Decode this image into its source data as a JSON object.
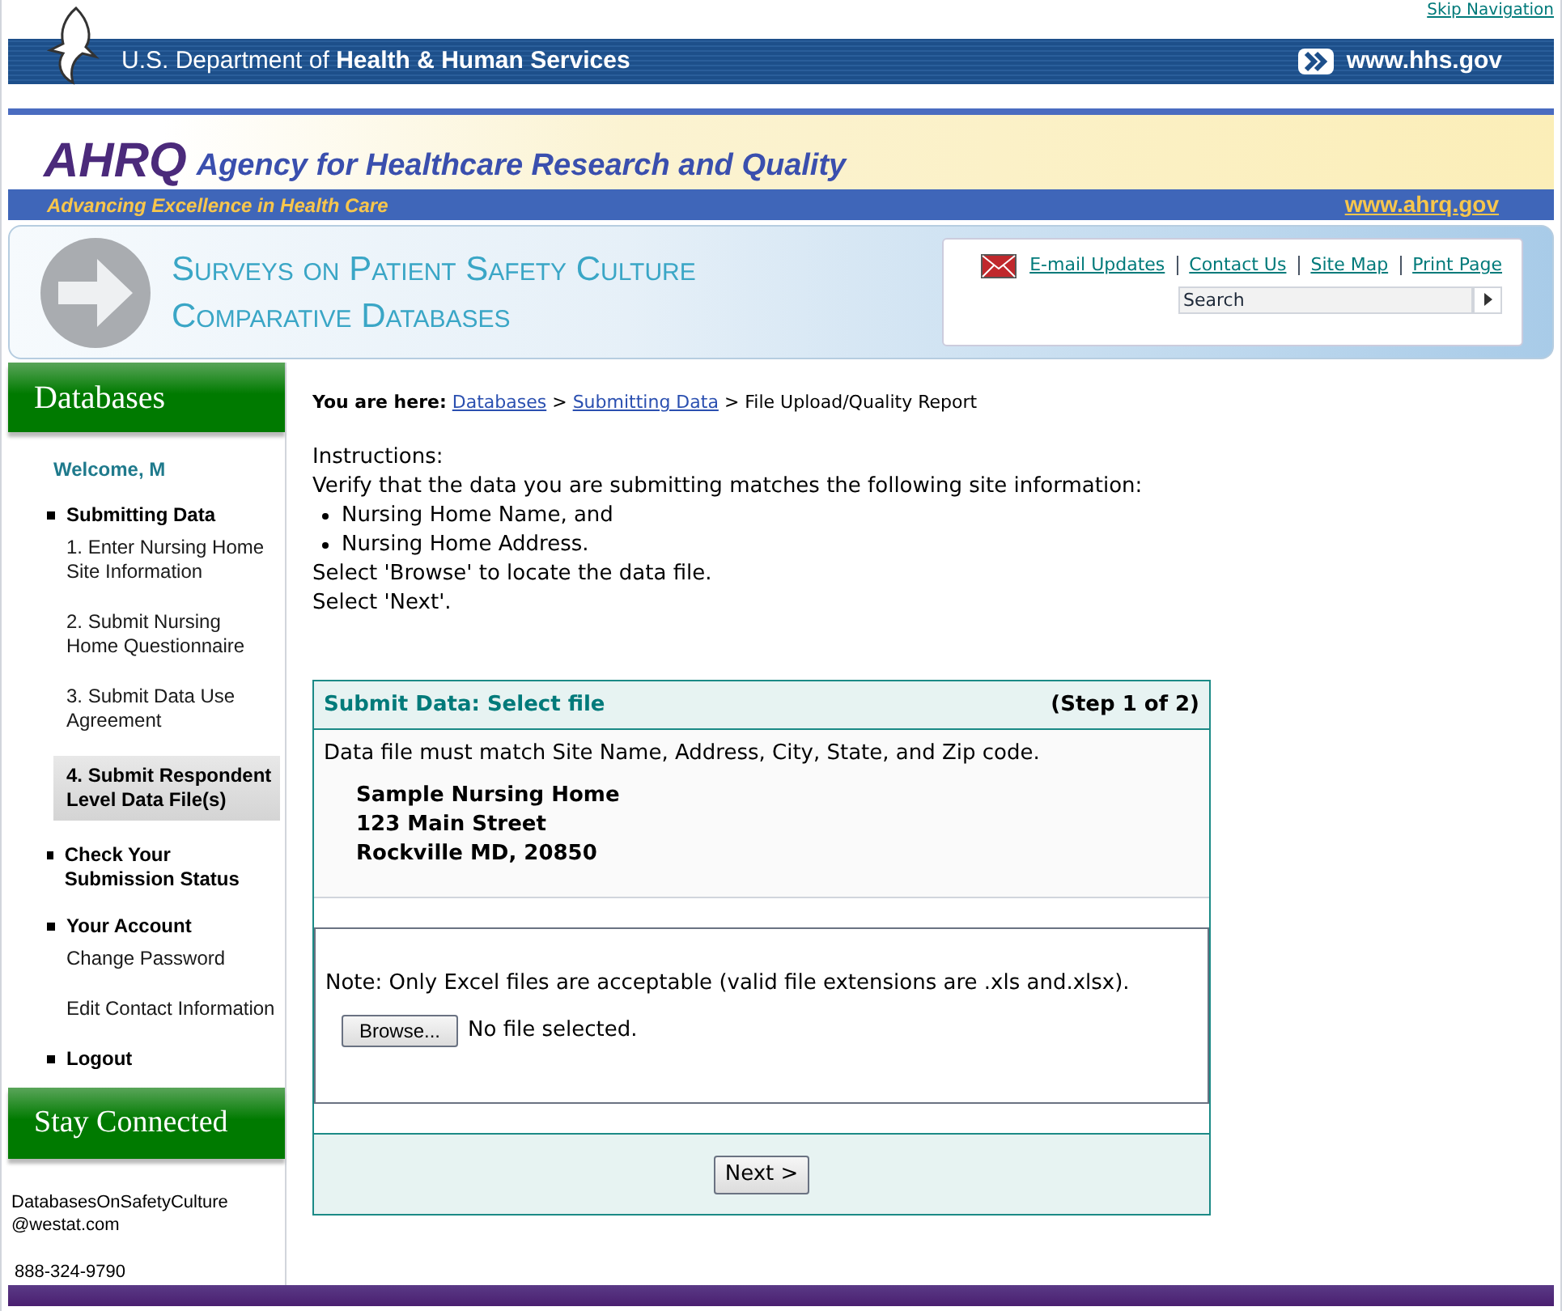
{
  "skip_link": "Skip Navigation",
  "hhs_bar": {
    "prefix": "U.S. Department of ",
    "name": "Health & Human Services",
    "link": "www.hhs.gov"
  },
  "agency": {
    "abbr": "AHRQ",
    "name": "Agency for Healthcare Research and Quality",
    "tagline": "Advancing Excellence in Health Care",
    "link": "www.ahrq.gov"
  },
  "banner": {
    "title_lines": [
      "Surveys on Patient Safety Culture",
      "Comparative Databases"
    ],
    "links": [
      "E-mail Updates",
      "Contact Us",
      "Site Map",
      "Print Page"
    ],
    "search": {
      "placeholder": "Search"
    }
  },
  "sidebar": {
    "heading": "Databases",
    "welcome": "Welcome, M",
    "sections": [
      {
        "title": "Submitting Data",
        "children": [
          {
            "label": "1. Enter Nursing Home Site Information",
            "selected": false
          },
          {
            "label": "2. Submit Nursing Home Questionnaire",
            "selected": false
          },
          {
            "label": "3. Submit Data Use Agreement",
            "selected": false
          },
          {
            "label": "4. Submit Respondent Level Data File(s)",
            "selected": true
          }
        ]
      },
      {
        "title": "Check Your Submission Status"
      },
      {
        "title": "Your Account",
        "children": [
          {
            "label": "Change Password",
            "selected": false
          },
          {
            "label": "Edit Contact Information",
            "selected": false
          }
        ]
      },
      {
        "title": "Logout"
      }
    ],
    "connect_heading": "Stay Connected",
    "email": "DatabasesOnSafetyCulture @westat.com",
    "phone": "888-324-9790"
  },
  "breadcrumb": {
    "label": "You are here:",
    "links": [
      "Databases",
      "Submitting Data"
    ],
    "current": "File Upload/Quality Report",
    "separator": ">"
  },
  "instructions": {
    "heading": "Instructions:",
    "intro": "Verify that the data you are submitting matches the following site information:",
    "bullets": [
      "Nursing Home Name, and",
      "Nursing Home Address."
    ],
    "steps": [
      "Select 'Browse' to locate the data file.",
      "Select 'Next'."
    ]
  },
  "panel": {
    "title": "Submit Data: Select file",
    "step": "(Step 1 of 2)",
    "match_note": "Data file must match Site Name, Address, City, State, and Zip code.",
    "address": [
      "Sample Nursing Home",
      "123 Main Street",
      "Rockville MD, 20850"
    ],
    "file_note": "Note: Only Excel files are acceptable (valid file extensions are .xls and.xlsx).",
    "browse_button": "Browse...",
    "file_status": "No file selected.",
    "next_button": "Next >"
  }
}
